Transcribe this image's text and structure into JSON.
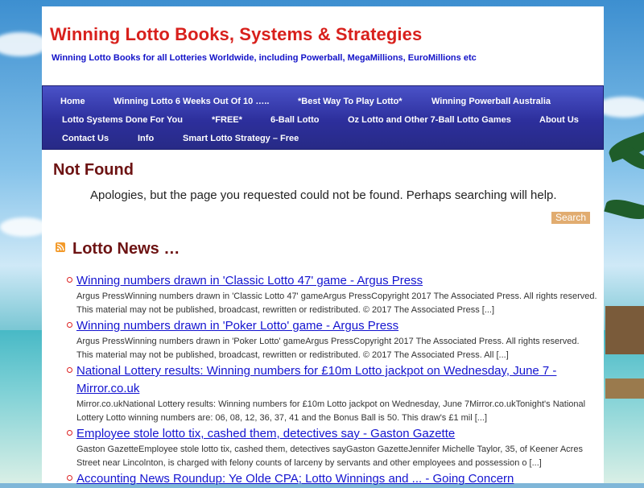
{
  "site": {
    "title": "Winning Lotto Books, Systems & Strategies",
    "description": "Winning Lotto Books for all Lotteries Worldwide, including Powerball, MegaMillions, EuroMillions etc"
  },
  "nav": [
    "Home",
    "Winning Lotto 6 Weeks Out Of 10 …..",
    "*Best Way To Play Lotto*",
    "Winning Powerball Australia",
    "Lotto Systems Done For You",
    "*FREE*",
    "6-Ball Lotto",
    "Oz Lotto and Other 7-Ball Lotto Games",
    "About Us",
    "Contact Us",
    "Info",
    "Smart Lotto Strategy – Free"
  ],
  "not_found": {
    "title": "Not Found",
    "message": "Apologies, but the page you requested could not be found. Perhaps searching will help.",
    "search_label": "Search"
  },
  "news": {
    "title": "Lotto News …",
    "items": [
      {
        "title": "Winning numbers drawn in 'Classic Lotto 47' game - Argus Press",
        "desc": "Argus PressWinning numbers drawn in 'Classic Lotto 47' gameArgus PressCopyright 2017 The Associated Press. All rights reserved. This material may not be published, broadcast, rewritten or redistributed. © 2017 The Associated Press [...]"
      },
      {
        "title": "Winning numbers drawn in 'Poker Lotto' game - Argus Press",
        "desc": "Argus PressWinning numbers drawn in 'Poker Lotto' gameArgus PressCopyright 2017 The Associated Press. All rights reserved. This material may not be published, broadcast, rewritten or redistributed. © 2017 The Associated Press. All [...]"
      },
      {
        "title": "National Lottery results: Winning numbers for £10m Lotto jackpot on Wednesday, June 7 - Mirror.co.uk",
        "desc": "Mirror.co.ukNational Lottery results: Winning numbers for £10m Lotto jackpot on Wednesday, June 7Mirror.co.ukTonight's National Lottery Lotto winning numbers are: 06, 08, 12, 36, 37, 41 and the Bonus Ball is 50. This draw's £1 mil [...]"
      },
      {
        "title": "Employee stole lotto tix, cashed them, detectives say - Gaston Gazette",
        "desc": "Gaston GazetteEmployee stole lotto tix, cashed them, detectives sayGaston GazetteJennifer Michelle Taylor, 35, of Keener Acres Street near Lincolnton, is charged with felony counts of larceny by servants and other employees and possession o [...]"
      },
      {
        "title": "Accounting News Roundup: Ye Olde CPA; Lotto Winnings and ... - Going Concern",
        "desc": ""
      }
    ]
  },
  "icons": {
    "rss": "rss-icon",
    "bullet": "circle-bullet-icon"
  },
  "colors": {
    "title_red": "#d8201c",
    "desc_blue": "#1212c8",
    "nav_blue": "#2d2f9c",
    "heading_maroon": "#6d1313",
    "link_blue": "#1414d0",
    "search_tan": "#e1ac70"
  }
}
